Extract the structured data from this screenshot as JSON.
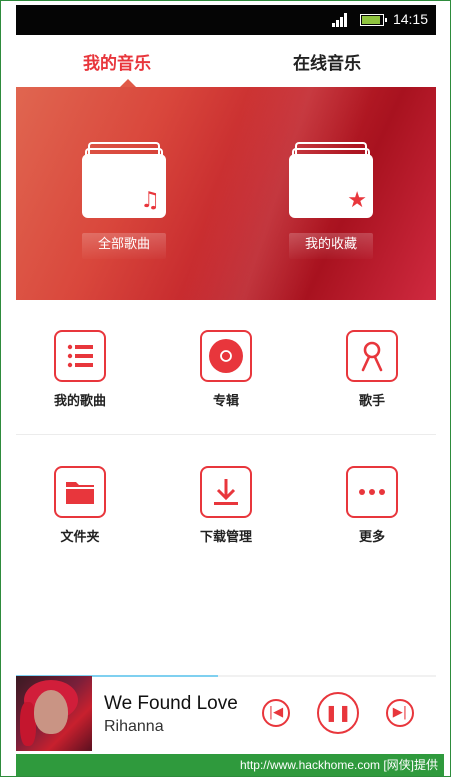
{
  "status_bar": {
    "time": "14:15"
  },
  "tabs": [
    {
      "label": "我的音乐",
      "active": true
    },
    {
      "label": "在线音乐",
      "active": false
    }
  ],
  "banner": {
    "all_songs": {
      "label": "全部歌曲",
      "icon": "music-note-icon"
    },
    "favorites": {
      "label": "我的收藏",
      "icon": "star-icon"
    }
  },
  "grid": [
    {
      "label": "我的歌曲",
      "icon": "list-icon"
    },
    {
      "label": "专辑",
      "icon": "disc-icon"
    },
    {
      "label": "歌手",
      "icon": "singer-icon"
    },
    {
      "label": "文件夹",
      "icon": "folder-icon"
    },
    {
      "label": "下载管理",
      "icon": "download-icon"
    },
    {
      "label": "更多",
      "icon": "more-icon"
    }
  ],
  "player": {
    "song": "We Found Love",
    "artist": "Rihanna",
    "progress": 0.48
  },
  "watermark": "http://www.hackhome.com [网侠]提供",
  "colors": {
    "accent": "#e8363c",
    "progress": "#7fd0f0",
    "watermark_bg": "#2f9a3d"
  }
}
